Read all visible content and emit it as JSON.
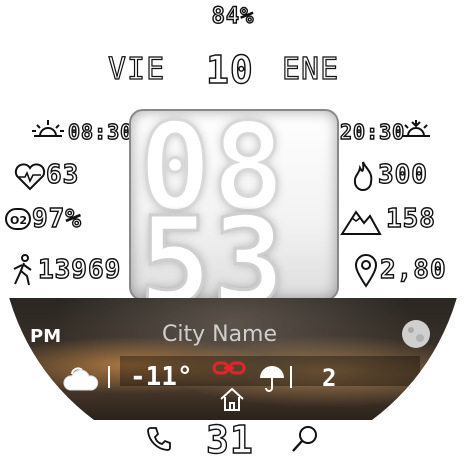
{
  "battery": "84%",
  "date": {
    "day": "VIE",
    "num": "10",
    "month": "ENE"
  },
  "time": {
    "hours": "08",
    "minutes": "53"
  },
  "left_stats": {
    "sunrise": "08:30",
    "heart_rate": "63",
    "spo2": "97%",
    "steps": "13969"
  },
  "right_stats": {
    "sunset": "20:30",
    "calories": "300",
    "elevation": "158",
    "distance": "2,80"
  },
  "weather": {
    "period": "PM",
    "city": "City Name",
    "temperature": "-11°",
    "rain_chance": "2"
  },
  "bottom": {
    "date_num": "31"
  },
  "colors": {
    "link_icon": "#e0262b",
    "city_text": "#cfcfcf"
  },
  "icons": [
    "sunrise-icon",
    "sunset-icon",
    "heart-icon",
    "flame-icon",
    "spo2-icon",
    "mountain-icon",
    "walking-icon",
    "location-pin-icon",
    "weather-cloud-icon",
    "link-icon",
    "umbrella-icon",
    "home-icon",
    "phone-icon",
    "search-icon",
    "moon-icon"
  ]
}
